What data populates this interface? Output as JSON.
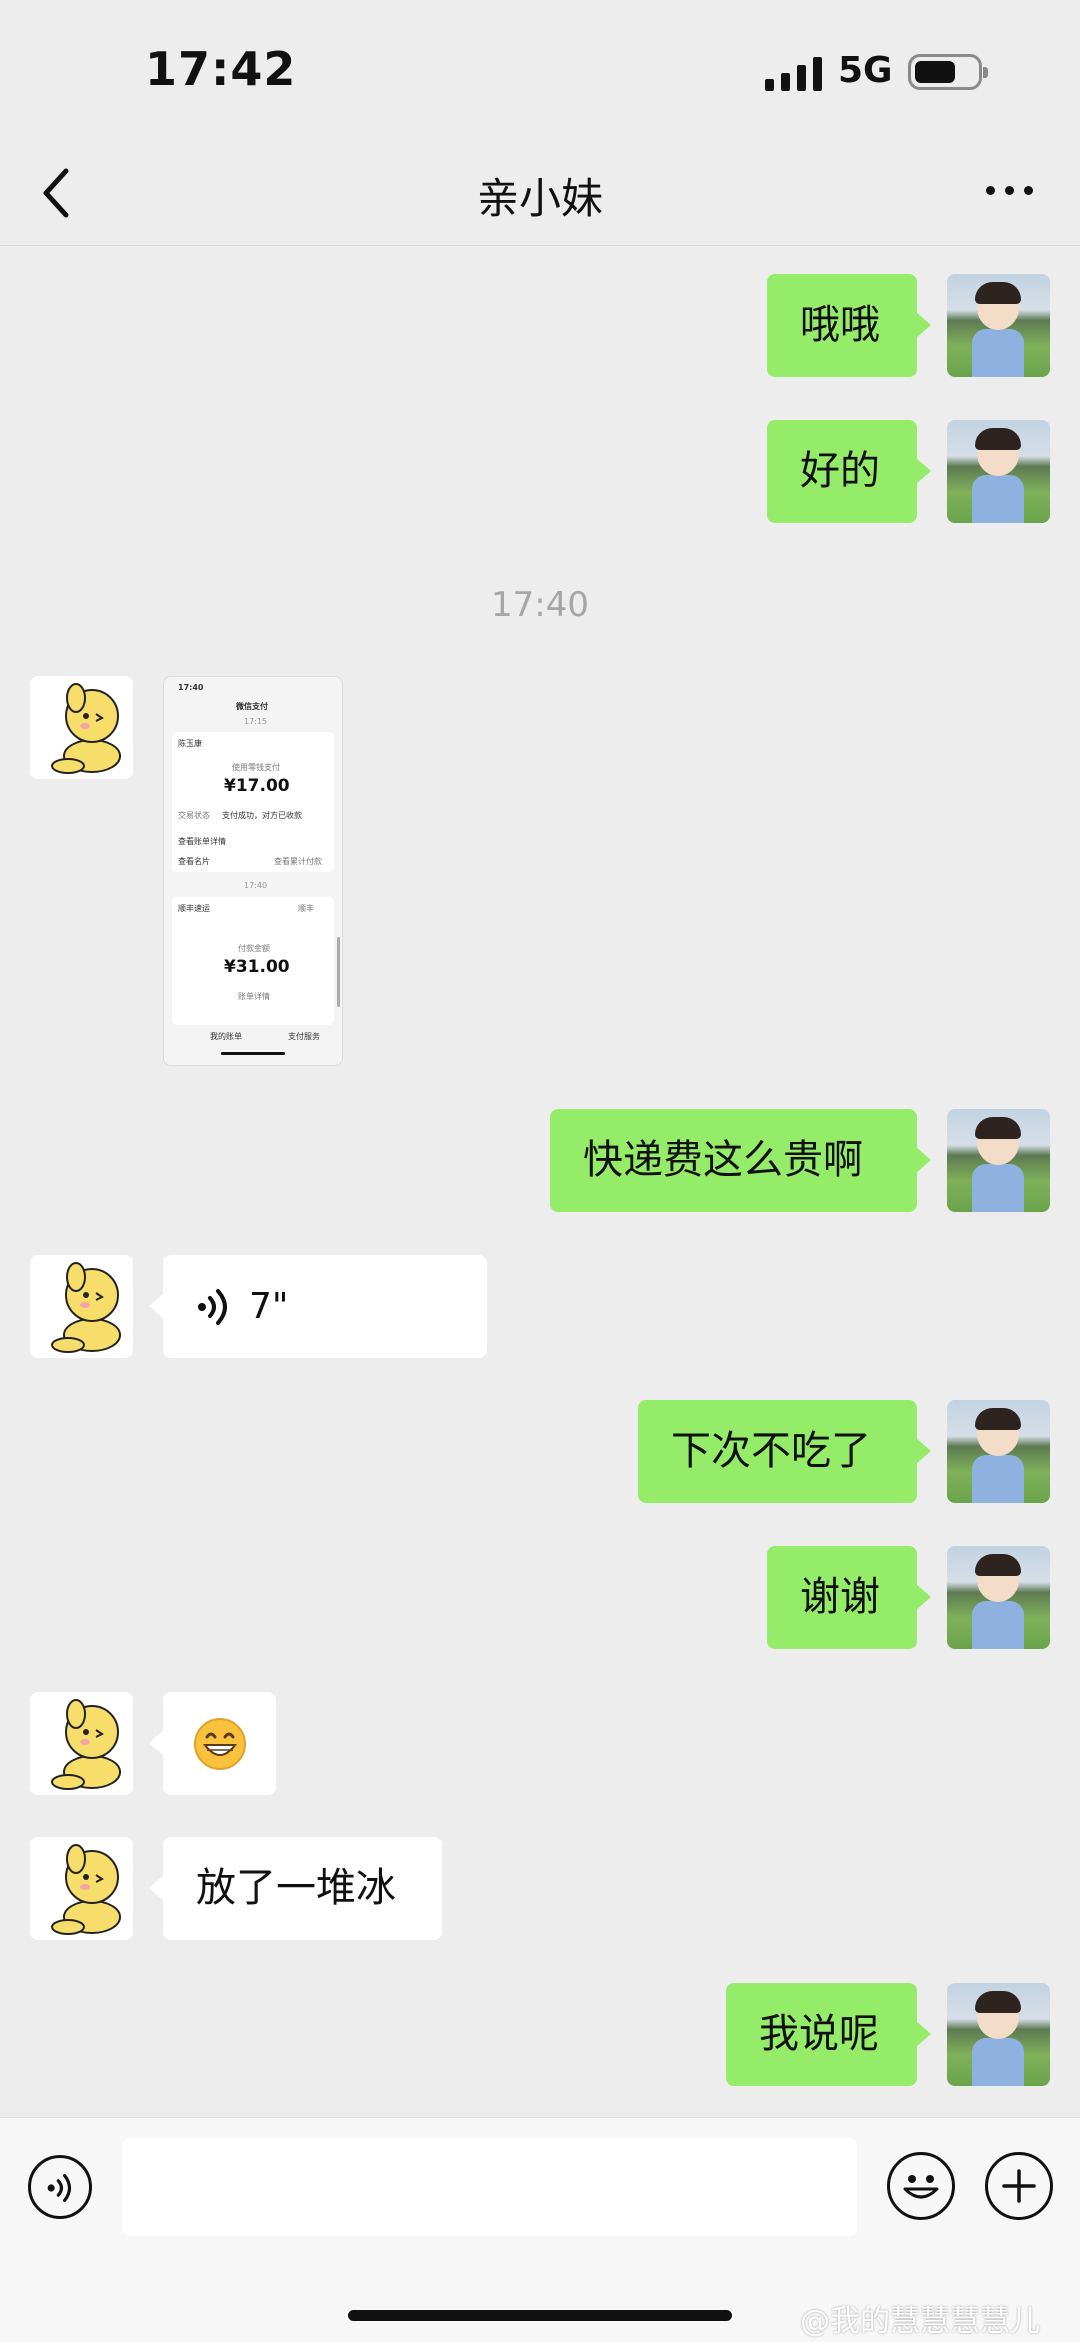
{
  "status": {
    "time": "17:42",
    "network": "5G"
  },
  "header": {
    "title": "亲小妹"
  },
  "timestamp": "17:40",
  "messages": {
    "m1": "哦哦",
    "m2": "好的",
    "m3": "快递费这么贵啊",
    "voice_duration": "7\"",
    "m5": "下次不吃了",
    "m6": "谢谢",
    "emoji": "😁",
    "m8": "放了一堆冰",
    "m9": "我说呢"
  },
  "screenshot": {
    "time": "17:40",
    "title": "微信支付",
    "ts1": "17:15",
    "merchant1": "陈玉康",
    "label1": "使用零钱支付",
    "amount1": "¥17.00",
    "status_label": "交易状态",
    "status_value": "支付成功，对方已收款",
    "link1": "查看账单详情",
    "link2": "查看名片",
    "link2_right": "查看累计付款",
    "ts2": "17:40",
    "merchant2": "顺丰速运",
    "merchant2_right": "顺丰",
    "label2": "付款金额",
    "amount2": "¥31.00",
    "detail": "账单详情",
    "tab1": "我的账单",
    "tab2": "支付服务"
  },
  "watermark": "@我的慧慧慧慧儿"
}
